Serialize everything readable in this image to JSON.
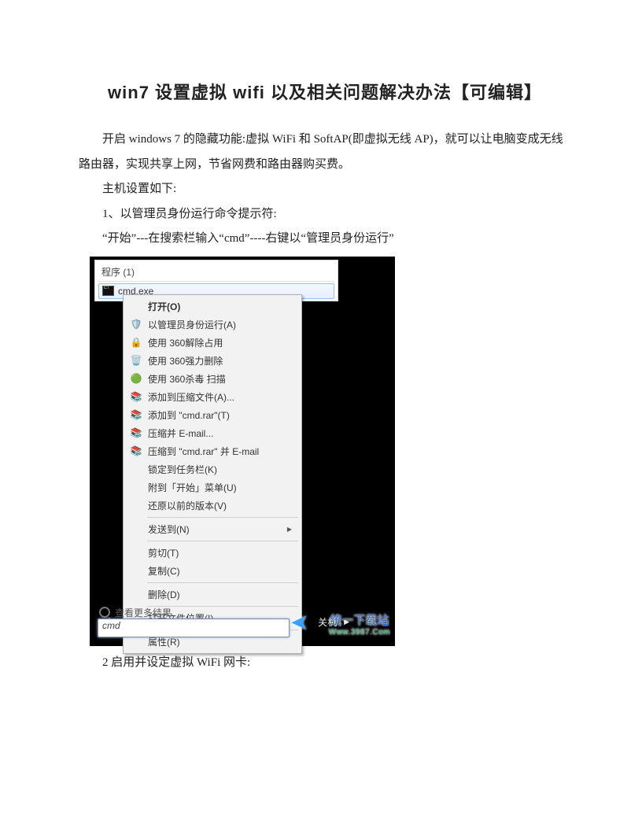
{
  "title": "win7 设置虚拟 wifi 以及相关问题解决办法【可编辑】",
  "para1": "开启 windows 7 的隐藏功能:虚拟 WiFi 和 SoftAP(即虚拟无线 AP)，就可以让电脑变成无线路由器，实现共享上网，节省网费和路由器购买费。",
  "para2": "主机设置如下:",
  "para3": "1、以管理员身份运行命令提示符:",
  "para4": "“开始”---在搜索栏输入“cmd”----右键以“管理员身份运行”",
  "para5": "2 启用并设定虚拟 WiFi 网卡:",
  "screenshot": {
    "programs_header": "程序 (1)",
    "result_item": "cmd.exe",
    "menu": {
      "open": "打开(O)",
      "run_admin": "以管理员身份运行(A)",
      "unlock360": "使用 360解除占用",
      "forcedel360": "使用 360强力删除",
      "scan360": "使用 360杀毒 扫描",
      "addcompress": "添加到压缩文件(A)...",
      "addrar": "添加到 \"cmd.rar\"(T)",
      "compress_email": "压缩并 E-mail...",
      "compress_email_rar": "压缩到 \"cmd.rar\" 并 E-mail",
      "pin_taskbar": "锁定到任务栏(K)",
      "pin_start": "附到「开始」菜单(U)",
      "restore": "还原以前的版本(V)",
      "sendto": "发送到(N)",
      "cut": "剪切(T)",
      "copy": "复制(C)",
      "delete": "删除(D)",
      "openloc": "打开文件位置(I)",
      "props": "属性(R)"
    },
    "more_results": "查看更多结果",
    "search_value": "cmd",
    "shutdown": "关机",
    "watermark_top": "统一下载站",
    "watermark_dom": "Www.3987.Com"
  }
}
